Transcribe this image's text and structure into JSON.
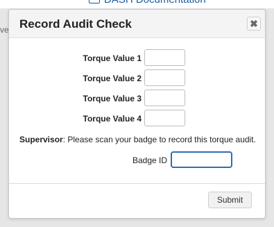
{
  "background": {
    "top_link": "DASH Documentation",
    "side_fragment": "ver"
  },
  "dialog": {
    "title": "Record Audit Check",
    "close_glyph": "✖",
    "fields": [
      {
        "label": "Torque Value 1",
        "value": ""
      },
      {
        "label": "Torque Value 2",
        "value": ""
      },
      {
        "label": "Torque Value 3",
        "value": ""
      },
      {
        "label": "Torque Value 4",
        "value": ""
      }
    ],
    "note_strong": "Supervisor",
    "note_text": ": Please scan your badge to record this torque audit.",
    "badge_label": "Badge ID",
    "badge_value": "",
    "submit_label": "Submit"
  },
  "colors": {
    "accent": "#2f6db3",
    "link": "#1a5a9c"
  }
}
